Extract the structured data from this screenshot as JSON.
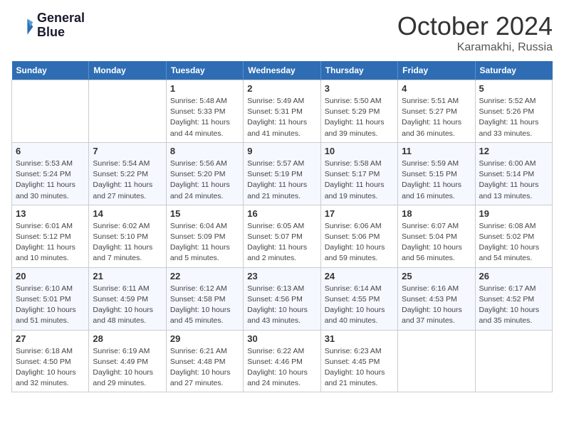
{
  "header": {
    "logo_line1": "General",
    "logo_line2": "Blue",
    "month": "October 2024",
    "location": "Karamakhi, Russia"
  },
  "days_of_week": [
    "Sunday",
    "Monday",
    "Tuesday",
    "Wednesday",
    "Thursday",
    "Friday",
    "Saturday"
  ],
  "weeks": [
    [
      {
        "day": "",
        "sunrise": "",
        "sunset": "",
        "daylight": ""
      },
      {
        "day": "",
        "sunrise": "",
        "sunset": "",
        "daylight": ""
      },
      {
        "day": "1",
        "sunrise": "Sunrise: 5:48 AM",
        "sunset": "Sunset: 5:33 PM",
        "daylight": "Daylight: 11 hours and 44 minutes."
      },
      {
        "day": "2",
        "sunrise": "Sunrise: 5:49 AM",
        "sunset": "Sunset: 5:31 PM",
        "daylight": "Daylight: 11 hours and 41 minutes."
      },
      {
        "day": "3",
        "sunrise": "Sunrise: 5:50 AM",
        "sunset": "Sunset: 5:29 PM",
        "daylight": "Daylight: 11 hours and 39 minutes."
      },
      {
        "day": "4",
        "sunrise": "Sunrise: 5:51 AM",
        "sunset": "Sunset: 5:27 PM",
        "daylight": "Daylight: 11 hours and 36 minutes."
      },
      {
        "day": "5",
        "sunrise": "Sunrise: 5:52 AM",
        "sunset": "Sunset: 5:26 PM",
        "daylight": "Daylight: 11 hours and 33 minutes."
      }
    ],
    [
      {
        "day": "6",
        "sunrise": "Sunrise: 5:53 AM",
        "sunset": "Sunset: 5:24 PM",
        "daylight": "Daylight: 11 hours and 30 minutes."
      },
      {
        "day": "7",
        "sunrise": "Sunrise: 5:54 AM",
        "sunset": "Sunset: 5:22 PM",
        "daylight": "Daylight: 11 hours and 27 minutes."
      },
      {
        "day": "8",
        "sunrise": "Sunrise: 5:56 AM",
        "sunset": "Sunset: 5:20 PM",
        "daylight": "Daylight: 11 hours and 24 minutes."
      },
      {
        "day": "9",
        "sunrise": "Sunrise: 5:57 AM",
        "sunset": "Sunset: 5:19 PM",
        "daylight": "Daylight: 11 hours and 21 minutes."
      },
      {
        "day": "10",
        "sunrise": "Sunrise: 5:58 AM",
        "sunset": "Sunset: 5:17 PM",
        "daylight": "Daylight: 11 hours and 19 minutes."
      },
      {
        "day": "11",
        "sunrise": "Sunrise: 5:59 AM",
        "sunset": "Sunset: 5:15 PM",
        "daylight": "Daylight: 11 hours and 16 minutes."
      },
      {
        "day": "12",
        "sunrise": "Sunrise: 6:00 AM",
        "sunset": "Sunset: 5:14 PM",
        "daylight": "Daylight: 11 hours and 13 minutes."
      }
    ],
    [
      {
        "day": "13",
        "sunrise": "Sunrise: 6:01 AM",
        "sunset": "Sunset: 5:12 PM",
        "daylight": "Daylight: 11 hours and 10 minutes."
      },
      {
        "day": "14",
        "sunrise": "Sunrise: 6:02 AM",
        "sunset": "Sunset: 5:10 PM",
        "daylight": "Daylight: 11 hours and 7 minutes."
      },
      {
        "day": "15",
        "sunrise": "Sunrise: 6:04 AM",
        "sunset": "Sunset: 5:09 PM",
        "daylight": "Daylight: 11 hours and 5 minutes."
      },
      {
        "day": "16",
        "sunrise": "Sunrise: 6:05 AM",
        "sunset": "Sunset: 5:07 PM",
        "daylight": "Daylight: 11 hours and 2 minutes."
      },
      {
        "day": "17",
        "sunrise": "Sunrise: 6:06 AM",
        "sunset": "Sunset: 5:06 PM",
        "daylight": "Daylight: 10 hours and 59 minutes."
      },
      {
        "day": "18",
        "sunrise": "Sunrise: 6:07 AM",
        "sunset": "Sunset: 5:04 PM",
        "daylight": "Daylight: 10 hours and 56 minutes."
      },
      {
        "day": "19",
        "sunrise": "Sunrise: 6:08 AM",
        "sunset": "Sunset: 5:02 PM",
        "daylight": "Daylight: 10 hours and 54 minutes."
      }
    ],
    [
      {
        "day": "20",
        "sunrise": "Sunrise: 6:10 AM",
        "sunset": "Sunset: 5:01 PM",
        "daylight": "Daylight: 10 hours and 51 minutes."
      },
      {
        "day": "21",
        "sunrise": "Sunrise: 6:11 AM",
        "sunset": "Sunset: 4:59 PM",
        "daylight": "Daylight: 10 hours and 48 minutes."
      },
      {
        "day": "22",
        "sunrise": "Sunrise: 6:12 AM",
        "sunset": "Sunset: 4:58 PM",
        "daylight": "Daylight: 10 hours and 45 minutes."
      },
      {
        "day": "23",
        "sunrise": "Sunrise: 6:13 AM",
        "sunset": "Sunset: 4:56 PM",
        "daylight": "Daylight: 10 hours and 43 minutes."
      },
      {
        "day": "24",
        "sunrise": "Sunrise: 6:14 AM",
        "sunset": "Sunset: 4:55 PM",
        "daylight": "Daylight: 10 hours and 40 minutes."
      },
      {
        "day": "25",
        "sunrise": "Sunrise: 6:16 AM",
        "sunset": "Sunset: 4:53 PM",
        "daylight": "Daylight: 10 hours and 37 minutes."
      },
      {
        "day": "26",
        "sunrise": "Sunrise: 6:17 AM",
        "sunset": "Sunset: 4:52 PM",
        "daylight": "Daylight: 10 hours and 35 minutes."
      }
    ],
    [
      {
        "day": "27",
        "sunrise": "Sunrise: 6:18 AM",
        "sunset": "Sunset: 4:50 PM",
        "daylight": "Daylight: 10 hours and 32 minutes."
      },
      {
        "day": "28",
        "sunrise": "Sunrise: 6:19 AM",
        "sunset": "Sunset: 4:49 PM",
        "daylight": "Daylight: 10 hours and 29 minutes."
      },
      {
        "day": "29",
        "sunrise": "Sunrise: 6:21 AM",
        "sunset": "Sunset: 4:48 PM",
        "daylight": "Daylight: 10 hours and 27 minutes."
      },
      {
        "day": "30",
        "sunrise": "Sunrise: 6:22 AM",
        "sunset": "Sunset: 4:46 PM",
        "daylight": "Daylight: 10 hours and 24 minutes."
      },
      {
        "day": "31",
        "sunrise": "Sunrise: 6:23 AM",
        "sunset": "Sunset: 4:45 PM",
        "daylight": "Daylight: 10 hours and 21 minutes."
      },
      {
        "day": "",
        "sunrise": "",
        "sunset": "",
        "daylight": ""
      },
      {
        "day": "",
        "sunrise": "",
        "sunset": "",
        "daylight": ""
      }
    ]
  ]
}
